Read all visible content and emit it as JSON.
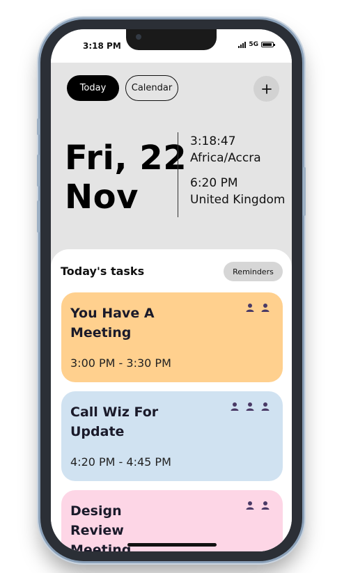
{
  "status": {
    "time": "3:18 PM",
    "network": "5G",
    "battery_level": 0.9
  },
  "header": {
    "today_label": "Today",
    "calendar_label": "Calendar",
    "add_icon": "plus-icon"
  },
  "date": {
    "line1": "Fri, 22",
    "line2": "Nov"
  },
  "clocks": [
    {
      "time": "3:18:47",
      "zone": "Africa/Accra"
    },
    {
      "time": "6:20 PM",
      "zone": "United Kingdom"
    }
  ],
  "tasks": {
    "title": "Today's tasks",
    "reminders_label": "Reminders",
    "items": [
      {
        "title": "You Have A Meeting",
        "time": "3:00 PM - 3:30 PM",
        "color": "#ffd08e",
        "participants": 2
      },
      {
        "title": "Call Wiz For Update",
        "time": "4:20 PM - 4:45 PM",
        "color": "#d0e2f1",
        "participants": 3
      },
      {
        "title": "Design Review Meeting",
        "time": "",
        "color": "#fdd6e6",
        "participants": 2
      }
    ]
  },
  "colors": {
    "accent": "#000000",
    "background": "#e4e4e4",
    "avatar": "#4a3a66"
  }
}
